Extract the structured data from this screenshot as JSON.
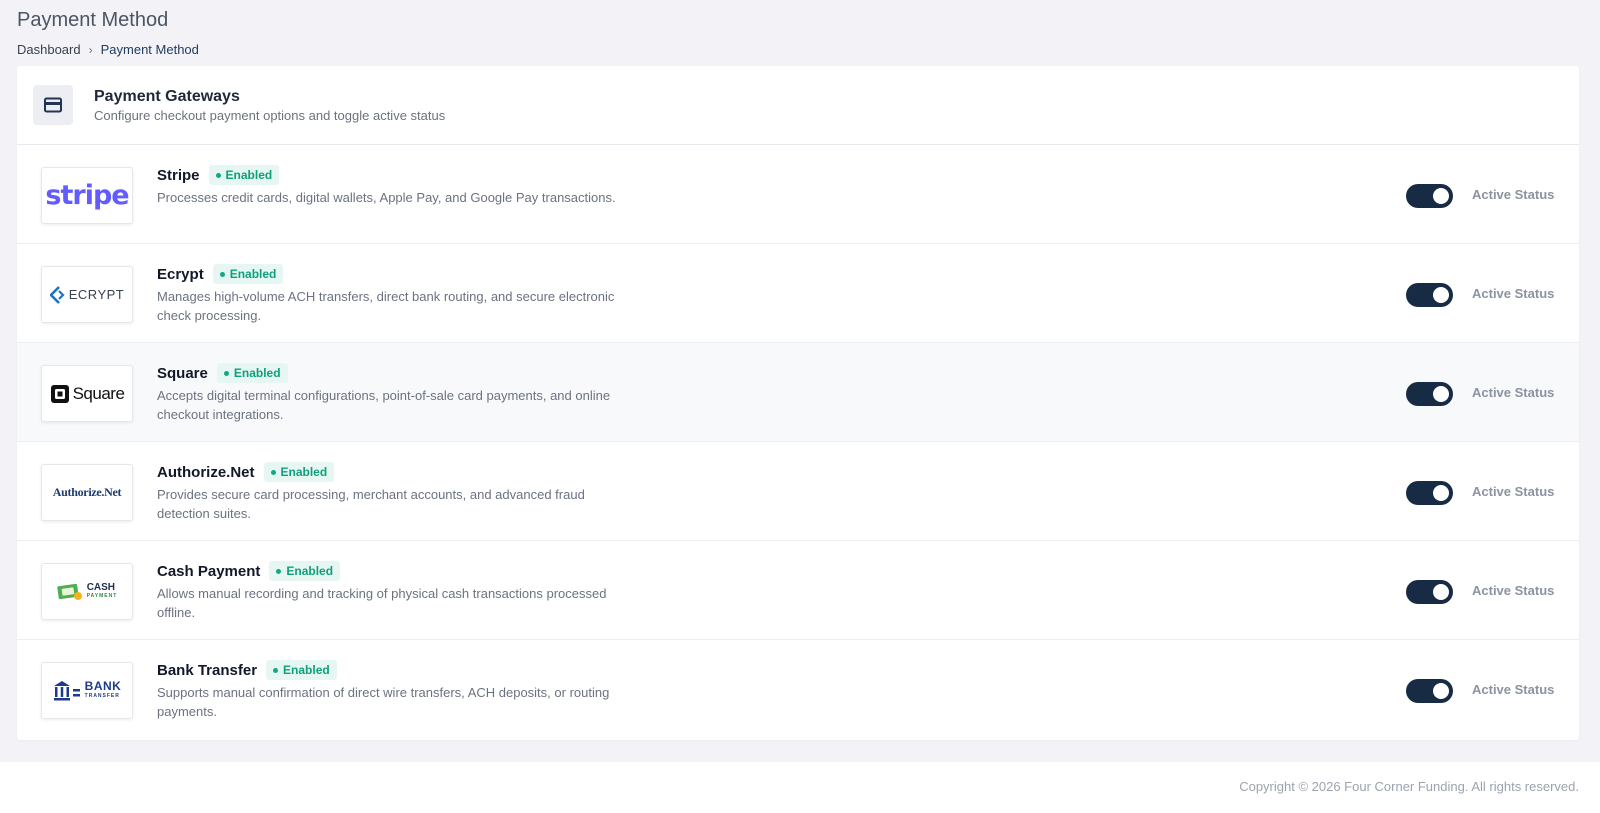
{
  "page": {
    "title": "Payment Method",
    "breadcrumb": {
      "home": "Dashboard",
      "separator": "›",
      "current": "Payment Method"
    }
  },
  "card": {
    "icon": "credit-card-icon",
    "title": "Payment Gateways",
    "subtitle": "Configure checkout payment options and toggle active status"
  },
  "gateways": [
    {
      "name": "Stripe",
      "badge": "Enabled",
      "logo_text": "stripe",
      "description": "Processes credit cards, digital wallets, Apple Pay, and Google Pay transactions.",
      "active": true,
      "status_label": "Active Status"
    },
    {
      "name": "Ecrypt",
      "badge": "Enabled",
      "logo_text": "ECRYPT",
      "description": "Manages high-volume ACH transfers, direct bank routing, and secure electronic check processing.",
      "active": true,
      "status_label": "Active Status"
    },
    {
      "name": "Square",
      "badge": "Enabled",
      "logo_text": "Square",
      "description": "Accepts digital terminal configurations, point-of-sale card payments, and online checkout integrations.",
      "active": true,
      "status_label": "Active Status"
    },
    {
      "name": "Authorize.Net",
      "badge": "Enabled",
      "logo_text": "Authorize.Net",
      "description": "Provides secure card processing, merchant accounts, and advanced fraud detection suites.",
      "active": true,
      "status_label": "Active Status"
    },
    {
      "name": "Cash Payment",
      "badge": "Enabled",
      "logo_text": "CASH",
      "logo_subtext": "PAYMENT",
      "description": "Allows manual recording and tracking of physical cash transactions processed offline.",
      "active": true,
      "status_label": "Active Status"
    },
    {
      "name": "Bank Transfer",
      "badge": "Enabled",
      "logo_text": "BANK",
      "logo_subtext": "TRANSFER",
      "description": "Supports manual confirmation of direct wire transfers, ACH deposits, or routing payments.",
      "active": true,
      "status_label": "Active Status"
    }
  ],
  "footer": {
    "copyright": "Copyright © 2026 Four Corner Funding. All rights reserved."
  },
  "colors": {
    "toggle_on": "#172b44",
    "badge_bg": "#e6f7f3",
    "badge_text": "#0f9f7b",
    "stripe_brand": "#635bff",
    "ecrypt_brand": "#1a73c9"
  }
}
